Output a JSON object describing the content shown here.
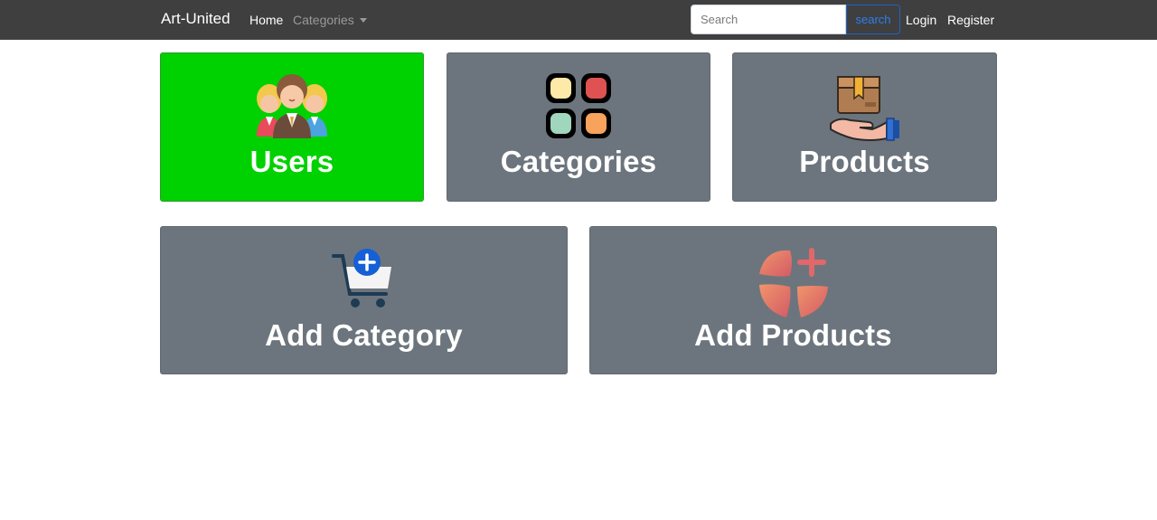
{
  "navbar": {
    "brand": "Art-United",
    "home_label": "Home",
    "categories_label": "Categories",
    "search_placeholder": "Search",
    "search_button_label": "search",
    "login_label": "Login",
    "register_label": "Register"
  },
  "cards": {
    "users": {
      "label": "Users",
      "icon": "users-group-icon"
    },
    "categories": {
      "label": "Categories",
      "icon": "categories-grid-icon"
    },
    "products": {
      "label": "Products",
      "icon": "box-hand-icon"
    },
    "add_category": {
      "label": "Add Category",
      "icon": "cart-plus-icon"
    },
    "add_products": {
      "label": "Add Products",
      "icon": "petals-plus-icon"
    }
  },
  "colors": {
    "navbar_bg": "#3f3f3f",
    "card_gray": "#6c757d",
    "card_active": "#00d100",
    "search_accent": "#2f7cf0"
  }
}
